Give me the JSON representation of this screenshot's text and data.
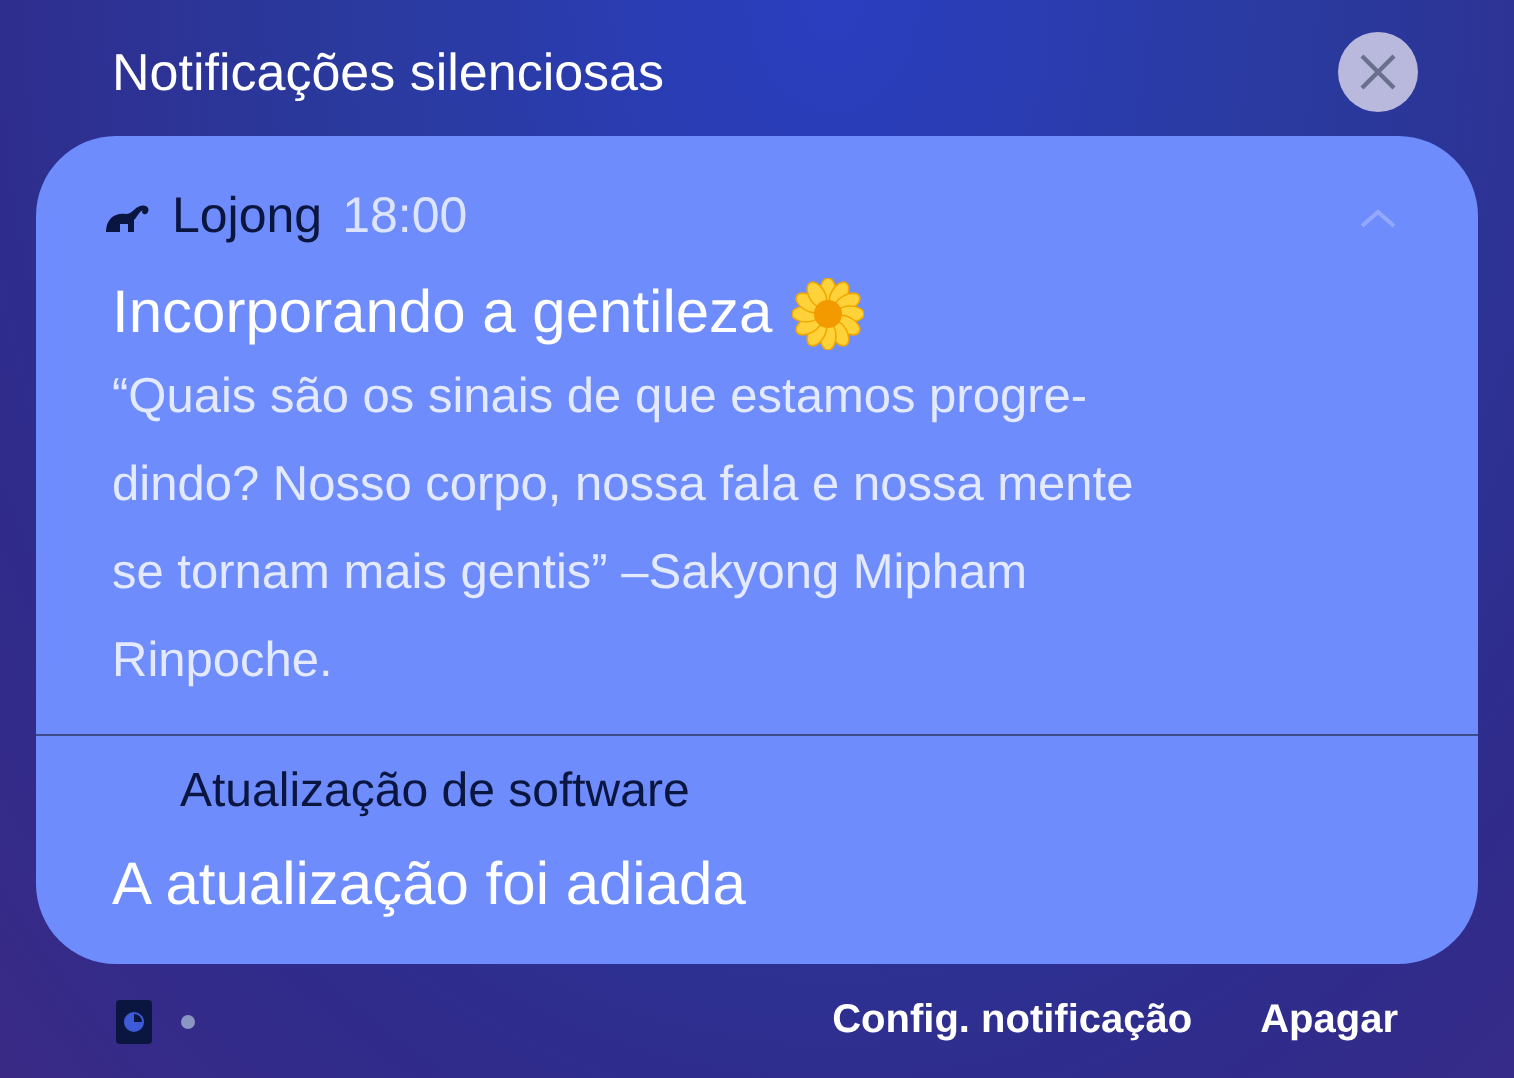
{
  "header": {
    "title": "Notificações silenciosas"
  },
  "notification": {
    "app": "Lojong",
    "time": "18:00",
    "expanded": true,
    "title": "Incorporando a gentileza",
    "body_lines": [
      "“Quais são os sinais de que estamos progre-",
      "dindo? Nosso corpo, nossa fala e nossa mente",
      "se tornam mais gentis” –Sakyong Mipham",
      "Rinpoche."
    ]
  },
  "next_notification": {
    "app": "Atualização de software",
    "title": "A atualização foi adiada"
  },
  "footer": {
    "buttons": [
      "Config. notificação",
      "Apagar"
    ]
  }
}
